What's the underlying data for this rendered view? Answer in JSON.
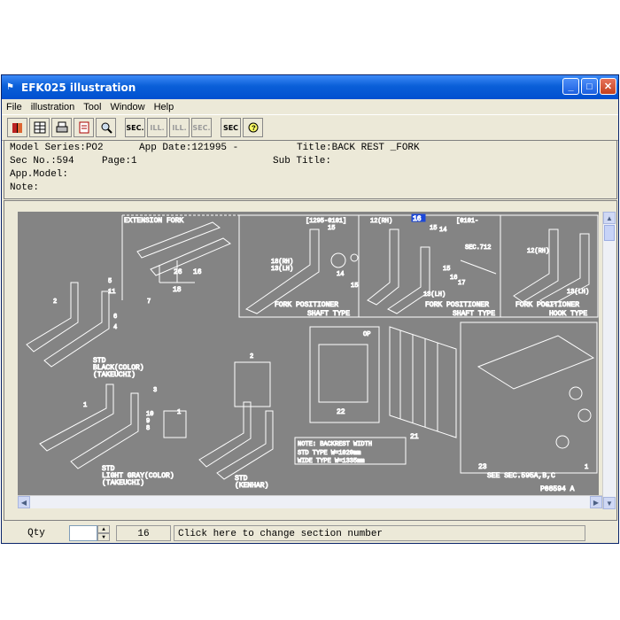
{
  "window": {
    "title": "EFK025 illustration",
    "controls": {
      "minimize": "_",
      "maximize": "□",
      "close": "✕"
    }
  },
  "menu": [
    "File",
    "illustration",
    "Tool",
    "Window",
    "Help"
  ],
  "toolbar": [
    {
      "icon": "book-icon",
      "label": ""
    },
    {
      "icon": "grid-icon",
      "label": ""
    },
    {
      "icon": "printer-icon",
      "label": ""
    },
    {
      "icon": "page-icon",
      "label": ""
    },
    {
      "icon": "magnifier-icon",
      "label": ""
    },
    {
      "icon": "sec-icon",
      "label": "SEC."
    },
    {
      "icon": "ill-back-icon",
      "label": "ILL."
    },
    {
      "icon": "ill-forward-icon",
      "label": "ILL."
    },
    {
      "icon": "sec-forward-icon",
      "label": "SEC."
    },
    {
      "icon": "sec-help-icon",
      "label": "SEC"
    },
    {
      "icon": "hint-icon",
      "label": ""
    }
  ],
  "info": {
    "model_series": "Model Series:PO2",
    "app_date": "App Date:121995 -",
    "title": "Title:BACK REST _FORK",
    "sec_no": "Sec No.:594",
    "page": "Page:1",
    "sub_title": "Sub Title:",
    "app_model": "App.Model:",
    "note": "Note:"
  },
  "drawing": {
    "labels": {
      "extension_fork": "EXTENSION FORK",
      "code1": "[1295-0101]",
      "code2": "[0101-",
      "fork_positioner_1": "FORK POSITIONER",
      "shaft_type_1": "SHAFT TYPE",
      "fork_positioner_2": "FORK POSITIONER",
      "shaft_type_2": "SHAFT TYPE",
      "fork_positioner_3": "FORK POSITIONER",
      "hook_type": "HOOK TYPE",
      "sec_712": "SEC.712",
      "std1": "STD",
      "black": "BLACK(COLOR)",
      "takeuchi1": "(TAKEUCHI)",
      "std2": "STD",
      "light_gray": "LIGHT GRAY(COLOR)",
      "takeuchi2": "(TAKEUCHI)",
      "std3": "STD",
      "kenhar": "(KENHAR)",
      "op": "OP",
      "note_title": "NOTE: BACKREST WIDTH",
      "std_type": "STD TYPE    W=1020mm",
      "wide_type": "WIDE TYPE   W=1335mm",
      "see_sec": "SEE SEC.595A,B,C",
      "fig_code": "P08594 A",
      "rh1": "12(RH)",
      "rh2": "12(RH)",
      "rh3": "12(RH)",
      "rh_lh": "18(RH)",
      "lh1": "13(LH)",
      "lh2": "13(LH)",
      "lh3": "13(LH)",
      "highlight": "16"
    },
    "callouts": [
      "26",
      "16",
      "18",
      "15",
      "14",
      "15",
      "15",
      "14",
      "15",
      "16",
      "17",
      "5",
      "11",
      "7",
      "6",
      "4",
      "2",
      "1",
      "3",
      "10",
      "9",
      "8",
      "1",
      "2",
      "22",
      "21",
      "23",
      "1"
    ]
  },
  "status": {
    "qty_label": "Qty",
    "qty_value": "",
    "section_number": "16",
    "change_hint": "Click here to change section number"
  }
}
